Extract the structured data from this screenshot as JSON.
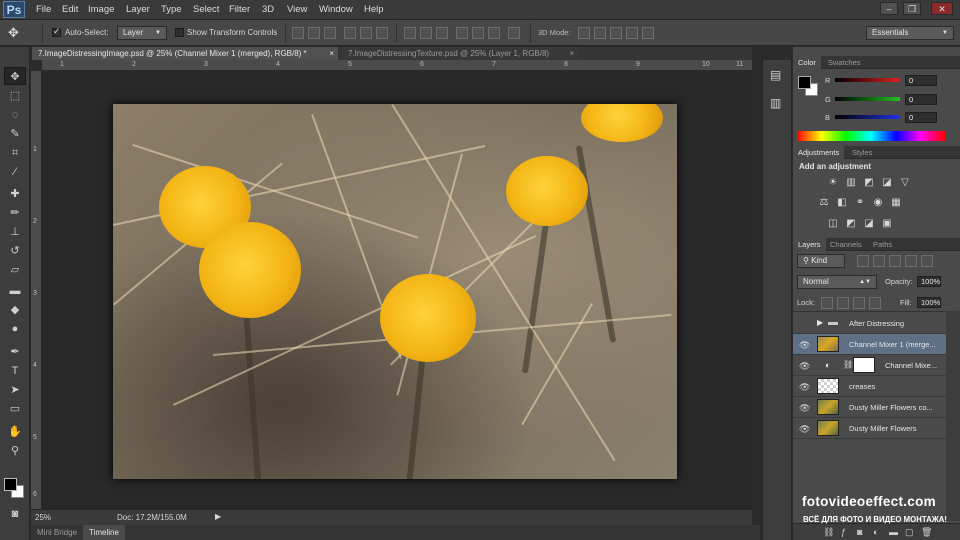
{
  "app": {
    "logo": "Ps"
  },
  "menu": [
    "File",
    "Edit",
    "Image",
    "Layer",
    "Type",
    "Select",
    "Filter",
    "3D",
    "View",
    "Window",
    "Help"
  ],
  "window_controls": [
    "–",
    "❐",
    "✕"
  ],
  "options": {
    "auto_select_label": "Auto-Select:",
    "auto_select_value": "Layer",
    "show_transform_label": "Show Transform Controls",
    "mode_3d_label": "3D Mode:",
    "workspace": "Essentials"
  },
  "doc_tabs": [
    {
      "label": "7.ImageDistressingImage.psd @ 25% (Channel Mixer 1 (merged), RGB/8) *",
      "close": "×"
    },
    {
      "label": "7.ImageDistressingTexture.psd @ 25% (Layer 1, RGB/8)",
      "close": "×"
    }
  ],
  "ruler_top": [
    "1",
    "2",
    "3",
    "4",
    "5",
    "6",
    "7",
    "8",
    "9",
    "10",
    "11"
  ],
  "ruler_left": [
    "1",
    "2",
    "3",
    "4",
    "5",
    "6"
  ],
  "status": {
    "zoom": "25%",
    "doc": "Doc: 17.2M/155.0M"
  },
  "bottom_tabs": [
    "Mini Bridge",
    "Timeline"
  ],
  "color_panel": {
    "tabs": [
      "Color",
      "Swatches"
    ],
    "channels": [
      {
        "label": "R",
        "value": "0",
        "color": "#e02020"
      },
      {
        "label": "G",
        "value": "0",
        "color": "#20c020"
      },
      {
        "label": "B",
        "value": "0",
        "color": "#2030e0"
      }
    ]
  },
  "adjustments": {
    "tabs": [
      "Adjustments",
      "Styles"
    ],
    "title": "Add an adjustment",
    "row1": [
      "☀",
      "▥",
      "◩",
      "◪",
      "▽"
    ],
    "row2": [
      "⚖",
      "◧",
      "⚭",
      "◉",
      "▦"
    ],
    "row3": [
      "◫",
      "◩",
      "◪",
      "▣"
    ]
  },
  "layers_panel": {
    "tabs": [
      "Layers",
      "Channels",
      "Paths"
    ],
    "kind_label": "Kind",
    "blend_mode": "Normal",
    "opacity_label": "Opacity:",
    "opacity_value": "100%",
    "lock_label": "Lock:",
    "fill_label": "Fill:",
    "fill_value": "100%",
    "layers": [
      {
        "name": "After Distressing",
        "type": "group",
        "visible": false
      },
      {
        "name": "Channel Mixer 1 (merge...",
        "type": "image",
        "visible": true,
        "selected": true
      },
      {
        "name": "Channel Mixe...",
        "type": "adjustment",
        "visible": true
      },
      {
        "name": "creases",
        "type": "transparent",
        "visible": true
      },
      {
        "name": "Dusty Miller Flowers co...",
        "type": "image",
        "visible": true
      },
      {
        "name": "Dusty Miller Flowers",
        "type": "image",
        "visible": true
      }
    ]
  },
  "watermark": {
    "site": "fotovideoeffect.com",
    "tagline": "ВСЁ ДЛЯ ФОТО И ВИДЕО МОНТАЖА!"
  },
  "colors": {
    "accent": "#5f6f86",
    "bg": "#2b2b2b",
    "panel": "#4a4a4a"
  }
}
